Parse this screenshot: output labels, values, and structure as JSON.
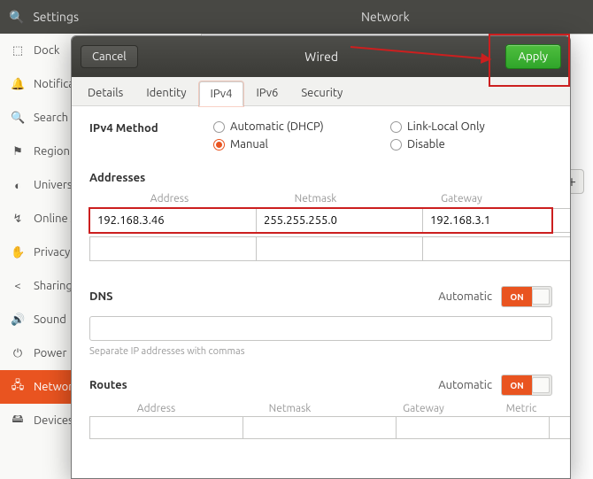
{
  "titlebar": {
    "left": "Settings",
    "right": "Network"
  },
  "sidebar": {
    "items": [
      {
        "icon": "⬚",
        "label": "Dock"
      },
      {
        "icon": "🔔",
        "label": "Notifications"
      },
      {
        "icon": "🔍",
        "label": "Search"
      },
      {
        "icon": "⚑",
        "label": "Region & Language"
      },
      {
        "icon": "◐",
        "label": "Universal Access"
      },
      {
        "icon": "↯",
        "label": "Online Accounts"
      },
      {
        "icon": "✋",
        "label": "Privacy"
      },
      {
        "icon": "<",
        "label": "Sharing"
      },
      {
        "icon": "🔊",
        "label": "Sound"
      },
      {
        "icon": "⏻",
        "label": "Power"
      },
      {
        "icon": "🖧",
        "label": "Network"
      },
      {
        "icon": "🖴",
        "label": "Devices"
      }
    ],
    "selected_index": 10
  },
  "dialog": {
    "cancel": "Cancel",
    "title": "Wired",
    "apply": "Apply",
    "tabs": [
      "Details",
      "Identity",
      "IPv4",
      "IPv6",
      "Security"
    ],
    "active_tab": 2,
    "ipv4": {
      "method_label": "IPv4 Method",
      "options": [
        "Automatic (DHCP)",
        "Link-Local Only",
        "Manual",
        "Disable"
      ],
      "selected": "Manual",
      "addresses_label": "Addresses",
      "addr_cols": [
        "Address",
        "Netmask",
        "Gateway"
      ],
      "rows": [
        {
          "address": "192.168.3.46",
          "netmask": "255.255.255.0",
          "gateway": "192.168.3.1"
        },
        {
          "address": "",
          "netmask": "",
          "gateway": ""
        }
      ],
      "dns_label": "DNS",
      "automatic_label": "Automatic",
      "switch_on": "ON",
      "dns_value": "",
      "dns_hint": "Separate IP addresses with commas",
      "routes_label": "Routes",
      "routes_cols": [
        "Address",
        "Netmask",
        "Gateway",
        "Metric"
      ],
      "route_row": {
        "address": "",
        "netmask": "",
        "gateway": "",
        "metric": ""
      }
    }
  }
}
